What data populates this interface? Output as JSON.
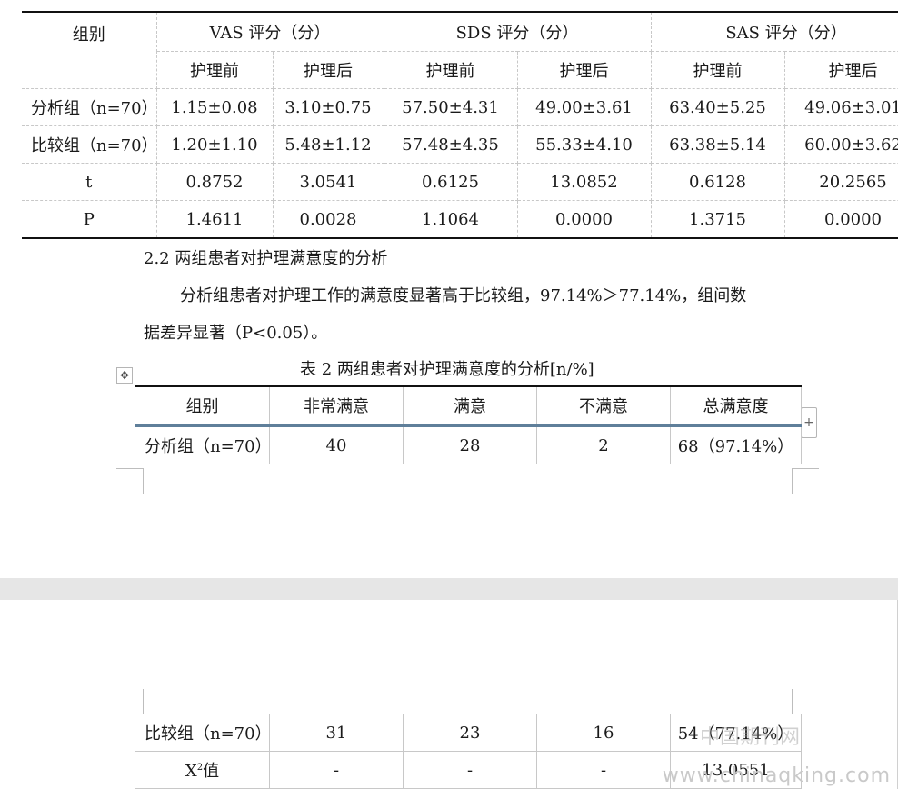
{
  "table1": {
    "header_group": "组别",
    "header_cols": [
      "VAS 评分（分）",
      "SDS 评分（分）",
      "SAS 评分（分）"
    ],
    "sub_headers": [
      "护理前",
      "护理后",
      "护理前",
      "护理后",
      "护理前",
      "护理后"
    ],
    "rows": [
      {
        "label": "分析组（n=70）",
        "cells": [
          "1.15±0.08",
          "3.10±0.75",
          "57.50±4.31",
          "49.00±3.61",
          "63.40±5.25",
          "49.06±3.01"
        ]
      },
      {
        "label": "比较组（n=70）",
        "cells": [
          "1.20±1.10",
          "5.48±1.12",
          "57.48±4.35",
          "55.33±4.10",
          "63.38±5.14",
          "60.00±3.62"
        ]
      },
      {
        "label": "t",
        "cells": [
          "0.8752",
          "3.0541",
          "0.6125",
          "13.0852",
          "0.6128",
          "20.2565"
        ]
      },
      {
        "label": "P",
        "cells": [
          "1.4611",
          "0.0028",
          "1.1064",
          "0.0000",
          "1.3715",
          "0.0000"
        ]
      }
    ]
  },
  "section_heading": "2.2 两组患者对护理满意度的分析",
  "paragraph": {
    "line1": "分析组患者对护理工作的满意度显著高于比较组，97.14%＞77.14%，组间数",
    "line2": "据差异显著（P<0.05）。"
  },
  "caption": "表 2 两组患者对护理满意度的分析[n/%]",
  "table2": {
    "headers": [
      "组别",
      "非常满意",
      "满意",
      "不满意",
      "总满意度"
    ],
    "row": {
      "label": "分析组（n=70）",
      "cells": [
        "40",
        "28",
        "2",
        "68（97.14%）"
      ]
    }
  },
  "table2_cont": {
    "rows": [
      {
        "label": "比较组（n=70）",
        "cells": [
          "31",
          "23",
          "16",
          "54（77.14%）"
        ]
      },
      {
        "label": "X",
        "sup": "2",
        "suffix": "值",
        "cells": [
          "-",
          "-",
          "-",
          "13.0551"
        ]
      }
    ]
  },
  "icons": {
    "move": "move-handle-icon",
    "add": "add-column-icon"
  },
  "watermark": {
    "cn": "中国期刊网",
    "url": "www.chinaqking.com"
  }
}
